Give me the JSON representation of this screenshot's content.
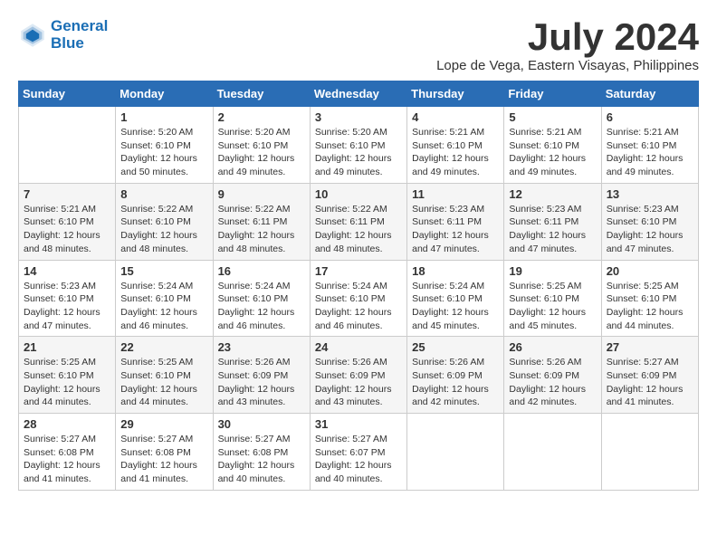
{
  "header": {
    "logo_line1": "General",
    "logo_line2": "Blue",
    "month": "July 2024",
    "location": "Lope de Vega, Eastern Visayas, Philippines"
  },
  "weekdays": [
    "Sunday",
    "Monday",
    "Tuesday",
    "Wednesday",
    "Thursday",
    "Friday",
    "Saturday"
  ],
  "weeks": [
    [
      {
        "day": "",
        "sunrise": "",
        "sunset": "",
        "daylight": ""
      },
      {
        "day": "1",
        "sunrise": "Sunrise: 5:20 AM",
        "sunset": "Sunset: 6:10 PM",
        "daylight": "Daylight: 12 hours and 50 minutes."
      },
      {
        "day": "2",
        "sunrise": "Sunrise: 5:20 AM",
        "sunset": "Sunset: 6:10 PM",
        "daylight": "Daylight: 12 hours and 49 minutes."
      },
      {
        "day": "3",
        "sunrise": "Sunrise: 5:20 AM",
        "sunset": "Sunset: 6:10 PM",
        "daylight": "Daylight: 12 hours and 49 minutes."
      },
      {
        "day": "4",
        "sunrise": "Sunrise: 5:21 AM",
        "sunset": "Sunset: 6:10 PM",
        "daylight": "Daylight: 12 hours and 49 minutes."
      },
      {
        "day": "5",
        "sunrise": "Sunrise: 5:21 AM",
        "sunset": "Sunset: 6:10 PM",
        "daylight": "Daylight: 12 hours and 49 minutes."
      },
      {
        "day": "6",
        "sunrise": "Sunrise: 5:21 AM",
        "sunset": "Sunset: 6:10 PM",
        "daylight": "Daylight: 12 hours and 49 minutes."
      }
    ],
    [
      {
        "day": "7",
        "sunrise": "Sunrise: 5:21 AM",
        "sunset": "Sunset: 6:10 PM",
        "daylight": "Daylight: 12 hours and 48 minutes."
      },
      {
        "day": "8",
        "sunrise": "Sunrise: 5:22 AM",
        "sunset": "Sunset: 6:10 PM",
        "daylight": "Daylight: 12 hours and 48 minutes."
      },
      {
        "day": "9",
        "sunrise": "Sunrise: 5:22 AM",
        "sunset": "Sunset: 6:11 PM",
        "daylight": "Daylight: 12 hours and 48 minutes."
      },
      {
        "day": "10",
        "sunrise": "Sunrise: 5:22 AM",
        "sunset": "Sunset: 6:11 PM",
        "daylight": "Daylight: 12 hours and 48 minutes."
      },
      {
        "day": "11",
        "sunrise": "Sunrise: 5:23 AM",
        "sunset": "Sunset: 6:11 PM",
        "daylight": "Daylight: 12 hours and 47 minutes."
      },
      {
        "day": "12",
        "sunrise": "Sunrise: 5:23 AM",
        "sunset": "Sunset: 6:11 PM",
        "daylight": "Daylight: 12 hours and 47 minutes."
      },
      {
        "day": "13",
        "sunrise": "Sunrise: 5:23 AM",
        "sunset": "Sunset: 6:10 PM",
        "daylight": "Daylight: 12 hours and 47 minutes."
      }
    ],
    [
      {
        "day": "14",
        "sunrise": "Sunrise: 5:23 AM",
        "sunset": "Sunset: 6:10 PM",
        "daylight": "Daylight: 12 hours and 47 minutes."
      },
      {
        "day": "15",
        "sunrise": "Sunrise: 5:24 AM",
        "sunset": "Sunset: 6:10 PM",
        "daylight": "Daylight: 12 hours and 46 minutes."
      },
      {
        "day": "16",
        "sunrise": "Sunrise: 5:24 AM",
        "sunset": "Sunset: 6:10 PM",
        "daylight": "Daylight: 12 hours and 46 minutes."
      },
      {
        "day": "17",
        "sunrise": "Sunrise: 5:24 AM",
        "sunset": "Sunset: 6:10 PM",
        "daylight": "Daylight: 12 hours and 46 minutes."
      },
      {
        "day": "18",
        "sunrise": "Sunrise: 5:24 AM",
        "sunset": "Sunset: 6:10 PM",
        "daylight": "Daylight: 12 hours and 45 minutes."
      },
      {
        "day": "19",
        "sunrise": "Sunrise: 5:25 AM",
        "sunset": "Sunset: 6:10 PM",
        "daylight": "Daylight: 12 hours and 45 minutes."
      },
      {
        "day": "20",
        "sunrise": "Sunrise: 5:25 AM",
        "sunset": "Sunset: 6:10 PM",
        "daylight": "Daylight: 12 hours and 44 minutes."
      }
    ],
    [
      {
        "day": "21",
        "sunrise": "Sunrise: 5:25 AM",
        "sunset": "Sunset: 6:10 PM",
        "daylight": "Daylight: 12 hours and 44 minutes."
      },
      {
        "day": "22",
        "sunrise": "Sunrise: 5:25 AM",
        "sunset": "Sunset: 6:10 PM",
        "daylight": "Daylight: 12 hours and 44 minutes."
      },
      {
        "day": "23",
        "sunrise": "Sunrise: 5:26 AM",
        "sunset": "Sunset: 6:09 PM",
        "daylight": "Daylight: 12 hours and 43 minutes."
      },
      {
        "day": "24",
        "sunrise": "Sunrise: 5:26 AM",
        "sunset": "Sunset: 6:09 PM",
        "daylight": "Daylight: 12 hours and 43 minutes."
      },
      {
        "day": "25",
        "sunrise": "Sunrise: 5:26 AM",
        "sunset": "Sunset: 6:09 PM",
        "daylight": "Daylight: 12 hours and 42 minutes."
      },
      {
        "day": "26",
        "sunrise": "Sunrise: 5:26 AM",
        "sunset": "Sunset: 6:09 PM",
        "daylight": "Daylight: 12 hours and 42 minutes."
      },
      {
        "day": "27",
        "sunrise": "Sunrise: 5:27 AM",
        "sunset": "Sunset: 6:09 PM",
        "daylight": "Daylight: 12 hours and 41 minutes."
      }
    ],
    [
      {
        "day": "28",
        "sunrise": "Sunrise: 5:27 AM",
        "sunset": "Sunset: 6:08 PM",
        "daylight": "Daylight: 12 hours and 41 minutes."
      },
      {
        "day": "29",
        "sunrise": "Sunrise: 5:27 AM",
        "sunset": "Sunset: 6:08 PM",
        "daylight": "Daylight: 12 hours and 41 minutes."
      },
      {
        "day": "30",
        "sunrise": "Sunrise: 5:27 AM",
        "sunset": "Sunset: 6:08 PM",
        "daylight": "Daylight: 12 hours and 40 minutes."
      },
      {
        "day": "31",
        "sunrise": "Sunrise: 5:27 AM",
        "sunset": "Sunset: 6:07 PM",
        "daylight": "Daylight: 12 hours and 40 minutes."
      },
      {
        "day": "",
        "sunrise": "",
        "sunset": "",
        "daylight": ""
      },
      {
        "day": "",
        "sunrise": "",
        "sunset": "",
        "daylight": ""
      },
      {
        "day": "",
        "sunrise": "",
        "sunset": "",
        "daylight": ""
      }
    ]
  ]
}
